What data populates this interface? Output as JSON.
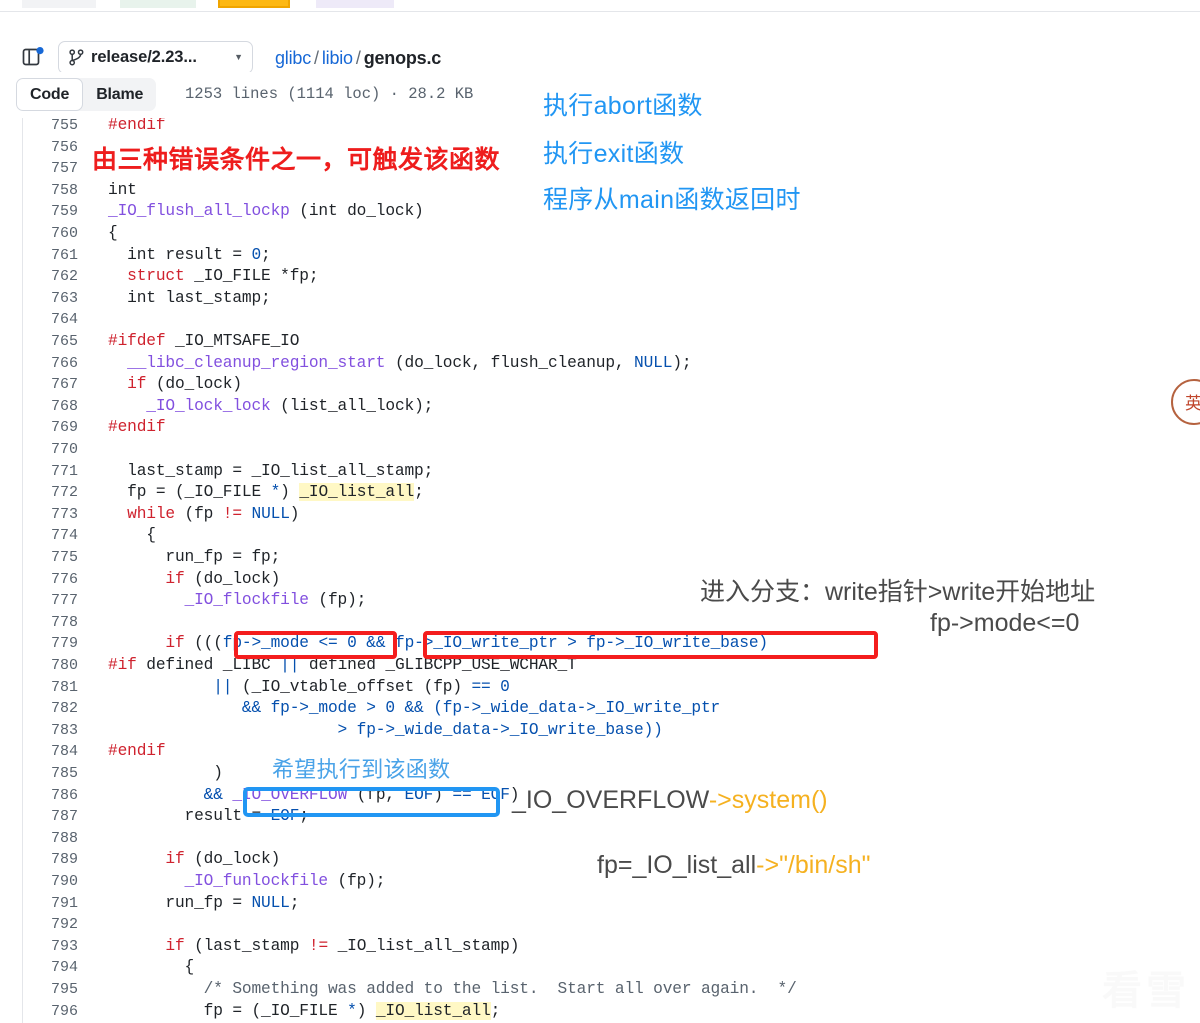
{
  "browser": {
    "tabs": [
      {
        "name": "tab-1",
        "color": "#f2f3f5"
      },
      {
        "name": "tab-2",
        "color": "#e8f3ec"
      },
      {
        "name": "tab-3-active",
        "color": "#fdb813"
      },
      {
        "name": "tab-4",
        "color": "#eeeaf8"
      }
    ]
  },
  "header": {
    "sidebar_toggle_icon": "side-panel-icon",
    "branch_icon": "branch-icon",
    "branch_label": "release/2.23...",
    "branch_caret_icon": "chevron-down-icon",
    "breadcrumb": {
      "repo": "glibc",
      "folder": "libio",
      "file": "genops.c",
      "separator": "/"
    }
  },
  "toolbar": {
    "tab_code": "Code",
    "tab_blame": "Blame",
    "file_meta": "1253 lines (1114 loc) · 28.2 KB"
  },
  "annotations": {
    "red_trigger": "由三种错误条件之一，可触发该函数",
    "blue_abort": "执行abort函数",
    "blue_exit": "执行exit函数",
    "blue_main_return": "程序从main函数返回时",
    "branch_cond": "进入分支：write指针>write开始地址",
    "branch_mode": "fp->mode<=0",
    "want_exec": "希望执行到该函数",
    "overflow_label": "_IO_OVERFLOW",
    "overflow_arrow": "->",
    "overflow_target": "system()",
    "listall_label": "fp=_IO_list_all",
    "listall_arrow": "->",
    "listall_target": "\"/bin/sh\""
  },
  "seal": {
    "char": "英"
  },
  "watermark": {
    "text": "看雪"
  },
  "colors": {
    "accent_blue": "#1768d6",
    "annotation_red": "#ee1d1d",
    "annotation_blue": "#2196f3",
    "annotation_orange": "#f5b120",
    "highlight_yellow": "#fff8c5",
    "tab_active": "#fdb813"
  },
  "code": {
    "first_visible_line": 755,
    "lines": [
      {
        "n": "755",
        "html": "<span class=\"k\">#endif</span>"
      },
      {
        "n": "756",
        "html": ""
      },
      {
        "n": "757",
        "html": ""
      },
      {
        "n": "758",
        "html": "int"
      },
      {
        "n": "759",
        "html": "<span class=\"f\">_IO_flush_all_lockp</span> (int do_lock)"
      },
      {
        "n": "760",
        "html": "{"
      },
      {
        "n": "761",
        "html": "  int result = <span class=\"n\">0</span>;"
      },
      {
        "n": "762",
        "html": "  <span class=\"t\">struct</span> _IO_FILE *fp;"
      },
      {
        "n": "763",
        "html": "  int last_stamp;"
      },
      {
        "n": "764",
        "html": ""
      },
      {
        "n": "765",
        "html": "<span class=\"k\">#ifdef</span> _IO_MTSAFE_IO"
      },
      {
        "n": "766",
        "html": "  <span class=\"f\">__libc_cleanup_region_start</span> (do_lock, flush_cleanup, <span class=\"n\">NULL</span>);"
      },
      {
        "n": "767",
        "html": "  <span class=\"k\">if</span> (do_lock)"
      },
      {
        "n": "768",
        "html": "    <span class=\"f\">_IO_lock_lock</span> (list_all_lock);"
      },
      {
        "n": "769",
        "html": "<span class=\"k\">#endif</span>"
      },
      {
        "n": "770",
        "html": ""
      },
      {
        "n": "771",
        "html": "  last_stamp = _IO_list_all_stamp;"
      },
      {
        "n": "772",
        "html": "  fp = (_IO_FILE <span class=\"n\">*</span>) <span class=\"hl\">_IO_list_all</span>;"
      },
      {
        "n": "773",
        "html": "  <span class=\"k\">while</span> (fp <span class=\"k\">!=</span> <span class=\"n\">NULL</span>)"
      },
      {
        "n": "774",
        "html": "    {"
      },
      {
        "n": "775",
        "html": "      run_fp = fp;"
      },
      {
        "n": "776",
        "html": "      <span class=\"k\">if</span> (do_lock)"
      },
      {
        "n": "777",
        "html": "        <span class=\"f\">_IO_flockfile</span> (fp);"
      },
      {
        "n": "778",
        "html": ""
      },
      {
        "n": "779",
        "html": "      <span class=\"k\">if</span> (((<span class=\"n\">fp-&gt;_mode &lt;= 0</span> <span class=\"n\">&amp;&amp;</span> <span class=\"n\">fp-&gt;_IO_write_ptr &gt; fp-&gt;_IO_write_base)</span>"
      },
      {
        "n": "780",
        "html": "<span class=\"k\">#if</span> defined _LIBC <span class=\"n\">||</span> defined _GLIBCPP_USE_WCHAR_T"
      },
      {
        "n": "781",
        "html": "           <span class=\"n\">||</span> (_IO_vtable_offset (fp) <span class=\"n\">== 0</span>"
      },
      {
        "n": "782",
        "html": "              <span class=\"n\">&amp;&amp; fp-&gt;_mode &gt; 0 &amp;&amp; (fp-&gt;_wide_data-&gt;_IO_write_ptr</span>"
      },
      {
        "n": "783",
        "html": "                        <span class=\"n\">&gt; fp-&gt;_wide_data-&gt;_IO_write_base))</span>"
      },
      {
        "n": "784",
        "html": "<span class=\"k\">#endif</span>"
      },
      {
        "n": "785",
        "html": "           )"
      },
      {
        "n": "786",
        "html": "          <span class=\"n\">&amp;&amp;</span> <span class=\"f\">_IO_OVERFLOW</span> (fp, <span class=\"n\">EOF</span>) <span class=\"n\">== EOF</span>)"
      },
      {
        "n": "787",
        "html": "        result = <span class=\"n\">EOF</span>;"
      },
      {
        "n": "788",
        "html": ""
      },
      {
        "n": "789",
        "html": "      <span class=\"k\">if</span> (do_lock)"
      },
      {
        "n": "790",
        "html": "        <span class=\"f\">_IO_funlockfile</span> (fp);"
      },
      {
        "n": "791",
        "html": "      run_fp = <span class=\"n\">NULL</span>;"
      },
      {
        "n": "792",
        "html": ""
      },
      {
        "n": "793",
        "html": "      <span class=\"k\">if</span> (last_stamp <span class=\"k\">!=</span> _IO_list_all_stamp)"
      },
      {
        "n": "794",
        "html": "        {"
      },
      {
        "n": "795",
        "html": "          <span class=\"c\">/* Something was added to the list.  Start all over again.  */</span>"
      },
      {
        "n": "796",
        "html": "          fp = (_IO_FILE <span class=\"n\">*</span>) <span class=\"hl\">_IO_list_all</span>;"
      }
    ]
  }
}
